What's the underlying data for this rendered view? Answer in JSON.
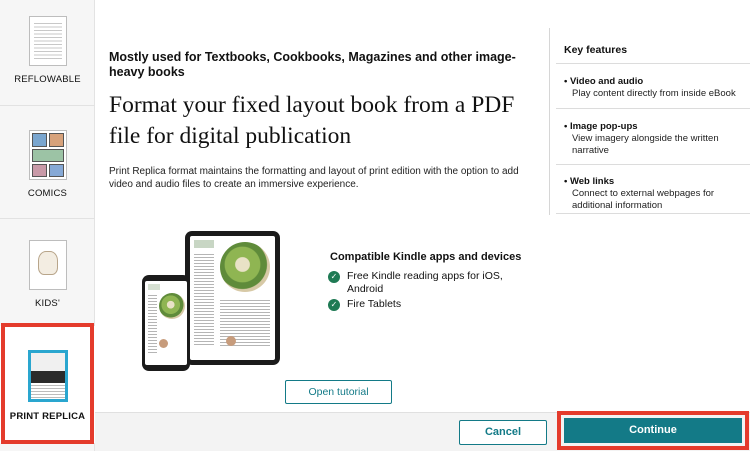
{
  "sidebar": {
    "items": [
      {
        "label": "REFLOWABLE"
      },
      {
        "label": "COMICS"
      },
      {
        "label": "KIDS'"
      },
      {
        "label": "PRINT REPLICA"
      }
    ],
    "selected": "PRINT REPLICA"
  },
  "main": {
    "subtitle": "Mostly used for Textbooks, Cookbooks, Magazines and other image-heavy books",
    "headline": "Format your fixed layout book from a PDF file for digital publication",
    "description": "Print Replica format maintains the formatting and layout of print edition with the option to add video and audio files to create an immersive experience.",
    "compat_title": "Compatible Kindle apps and devices",
    "compat_items": [
      "Free Kindle reading apps for iOS, Android",
      "Fire Tablets"
    ],
    "tutorial_label": "Open tutorial"
  },
  "key_features": {
    "title": "Key features",
    "items": [
      {
        "name": "Video and audio",
        "desc": "Play content directly from inside eBook"
      },
      {
        "name": "Image pop-ups",
        "desc": "View imagery alongside the written narrative"
      },
      {
        "name": "Web links",
        "desc": "Connect to external webpages for additional information"
      }
    ]
  },
  "footer": {
    "cancel_label": "Cancel",
    "continue_label": "Continue"
  },
  "colors": {
    "accent": "#137a87",
    "highlight": "#e43b2c",
    "check": "#1f7a54"
  }
}
